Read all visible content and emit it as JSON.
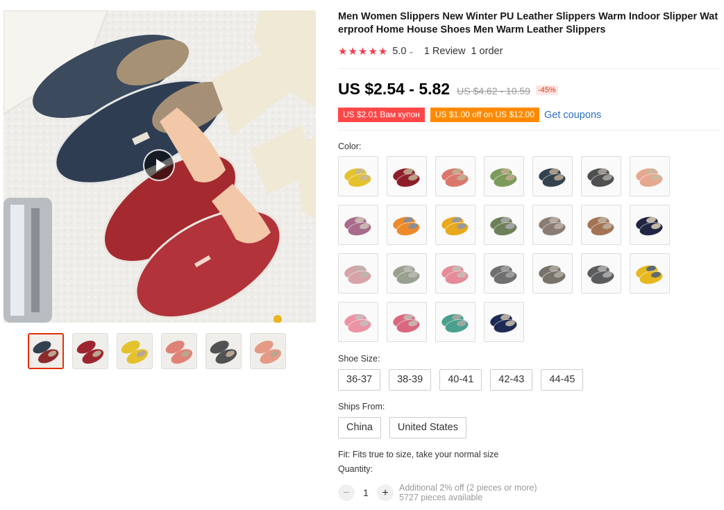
{
  "product": {
    "title": "Men Women Slippers New Winter PU Leather Slippers Warm Indoor Slipper Waterproof Home House Shoes Men Warm Leather Slippers",
    "rating": "5.0",
    "rating_stars": 5,
    "reviews": "1 Review",
    "orders": "1 order"
  },
  "price": {
    "current": "US $2.54 - 5.82",
    "original": "US $4.62 - 10.59",
    "discount": "-45%"
  },
  "coupons": {
    "coupon_1": "US $2.01 Вам купон",
    "coupon_2": "US $1.00 off on US $12.00",
    "get_coupons": "Get coupons"
  },
  "color": {
    "label": "Color:",
    "swatches": [
      {
        "body": "#e3c22e",
        "lining": "#c9b98a"
      },
      {
        "body": "#8c1f2a",
        "lining": "#b99f86"
      },
      {
        "body": "#d9776b",
        "lining": "#c3a98e"
      },
      {
        "body": "#7c9a5a",
        "lining": "#b9a888"
      },
      {
        "body": "#34424f",
        "lining": "#a89a86"
      },
      {
        "body": "#4d4f50",
        "lining": "#9d9a94"
      },
      {
        "body": "#e6a88e",
        "lining": "#cbb79e"
      },
      {
        "body": "#a86b8b",
        "lining": "#c8b6b0"
      },
      {
        "body": "#ee8a2a",
        "lining": "#8e8e8e"
      },
      {
        "body": "#e9a91c",
        "lining": "#9a9a9a"
      },
      {
        "body": "#6d7f58",
        "lining": "#a3a3a3"
      },
      {
        "body": "#8a7c72",
        "lining": "#b4aca4"
      },
      {
        "body": "#a37353",
        "lining": "#b9a896"
      },
      {
        "body": "#1f2542",
        "lining": "#c2b6a6"
      },
      {
        "body": "#d6a3a7",
        "lining": "#bfb3ad"
      },
      {
        "body": "#9aa08f",
        "lining": "#b8b6ae"
      },
      {
        "body": "#e58b99",
        "lining": "#c9b7b4"
      },
      {
        "body": "#6f6f6f",
        "lining": "#9c9c9c"
      },
      {
        "body": "#77736a",
        "lining": "#a8a49c"
      },
      {
        "body": "#5a5c5e",
        "lining": "#a5a5a5"
      },
      {
        "body": "#e6b81e",
        "lining": "#5f6b6e"
      },
      {
        "body": "#ec93a4",
        "lining": "#c9b9b8"
      },
      {
        "body": "#d9687e",
        "lining": "#c6b1ad"
      },
      {
        "body": "#4aa08e",
        "lining": "#9ea8a3"
      },
      {
        "body": "#1e2a55",
        "lining": "#b4aa9c"
      }
    ]
  },
  "shoe_size": {
    "label": "Shoe Size:",
    "options": [
      "36-37",
      "38-39",
      "40-41",
      "42-43",
      "44-45"
    ]
  },
  "ships_from": {
    "label": "Ships From:",
    "options": [
      "China",
      "United States"
    ]
  },
  "fit": "Fit: Fits true to size, take your normal size",
  "quantity": {
    "label": "Quantity:",
    "value": "1",
    "minus": "−",
    "plus": "+",
    "note_1": "Additional 2% off (2 pieces or more)",
    "note_2": "5727 pieces available"
  },
  "gallery": {
    "thumbnails": [
      {
        "color": "#8c2a2e",
        "accent": "#34424f",
        "active": true
      },
      {
        "color": "#9d2530",
        "accent": "#9d2530",
        "active": false
      },
      {
        "color": "#e3c22e",
        "accent": "#e3c22e",
        "active": false
      },
      {
        "color": "#df8377",
        "accent": "#df8377",
        "active": false
      },
      {
        "color": "#505254",
        "accent": "#505254",
        "active": false
      },
      {
        "color": "#e59a85",
        "accent": "#e59a85",
        "active": false
      }
    ]
  }
}
